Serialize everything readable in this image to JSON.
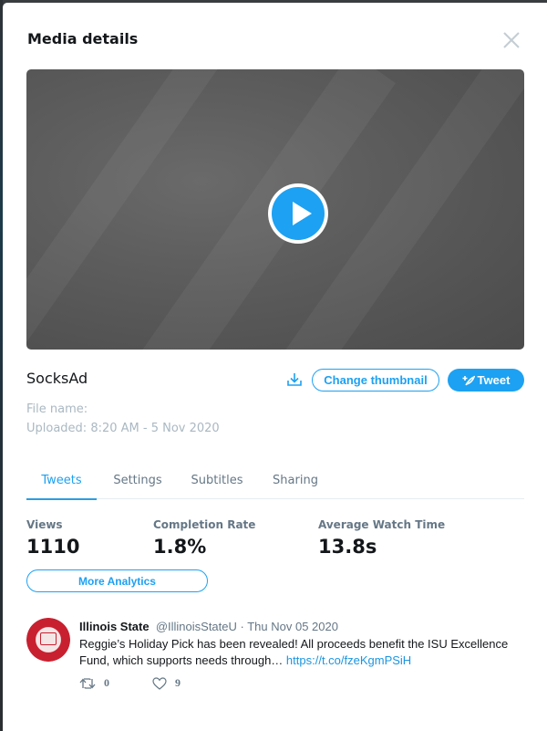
{
  "modal": {
    "title": "Media details",
    "close_icon": "close-icon"
  },
  "video": {
    "play_icon": "play-icon"
  },
  "media": {
    "name": "SocksAd",
    "file_name_label": "File name:",
    "uploaded_label": "Uploaded: 8:20 AM - 5 Nov 2020",
    "download_icon": "download-icon",
    "change_thumbnail_label": "Change thumbnail",
    "tweet_label": "Tweet",
    "tweet_icon": "compose-icon"
  },
  "tabs": [
    {
      "label": "Tweets",
      "active": true
    },
    {
      "label": "Settings",
      "active": false
    },
    {
      "label": "Subtitles",
      "active": false
    },
    {
      "label": "Sharing",
      "active": false
    }
  ],
  "stats": [
    {
      "label": "Views",
      "value": "1110"
    },
    {
      "label": "Completion Rate",
      "value": "1.8%"
    },
    {
      "label": "Average Watch Time",
      "value": "13.8s"
    }
  ],
  "more_analytics_label": "More Analytics",
  "tweet": {
    "name": "Illinois State",
    "handle": "@IllinoisStateU",
    "separator": " · ",
    "date": "Thu Nov 05 2020",
    "text": "Reggie’s Holiday Pick has been revealed! All proceeds benefit the ISU Excellence Fund, which supports needs through… ",
    "link": "https://t.co/fzeKgmPSiH",
    "retweets": "0",
    "likes": "9"
  },
  "colors": {
    "accent": "#1da1f2",
    "text_primary": "#14171a",
    "text_secondary": "#657786",
    "text_muted": "#aab8c2",
    "avatar_red": "#c8202f"
  }
}
